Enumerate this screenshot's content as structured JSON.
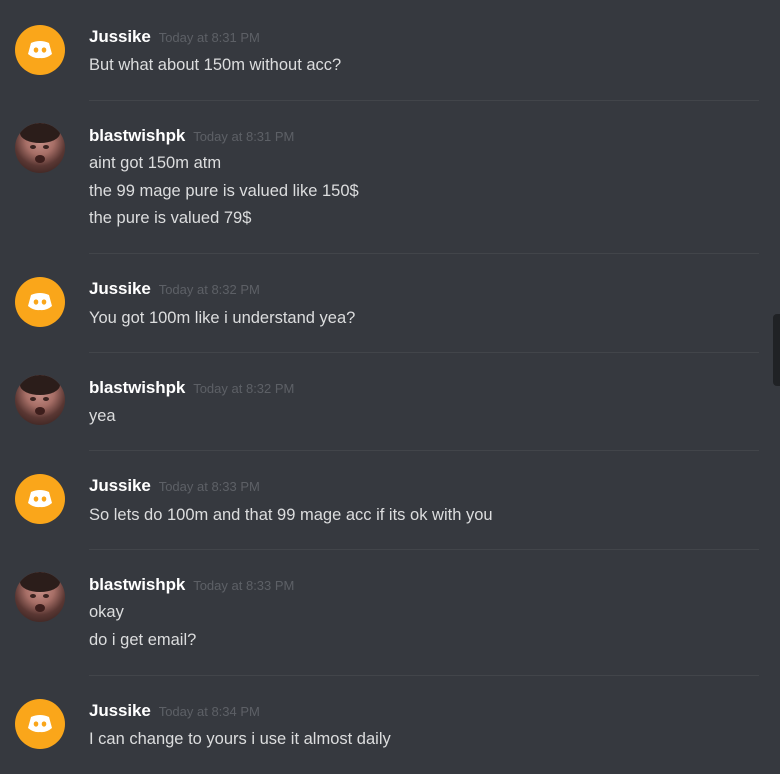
{
  "messages": [
    {
      "author": "Jussike",
      "avatar": "discord-logo-icon",
      "timestamp": "Today at 8:31 PM",
      "lines": [
        "But what about 150m without acc?"
      ]
    },
    {
      "author": "blastwishpk",
      "avatar": "user-photo",
      "timestamp": "Today at 8:31 PM",
      "lines": [
        "aint got 150m atm",
        "the 99 mage pure is valued like 150$",
        "the pure is valued 79$"
      ]
    },
    {
      "author": "Jussike",
      "avatar": "discord-logo-icon",
      "timestamp": "Today at 8:32 PM",
      "lines": [
        "You got 100m like i understand yea?"
      ]
    },
    {
      "author": "blastwishpk",
      "avatar": "user-photo",
      "timestamp": "Today at 8:32 PM",
      "lines": [
        "yea"
      ]
    },
    {
      "author": "Jussike",
      "avatar": "discord-logo-icon",
      "timestamp": "Today at 8:33 PM",
      "lines": [
        "So lets do 100m and that 99 mage acc if its ok with you"
      ]
    },
    {
      "author": "blastwishpk",
      "avatar": "user-photo",
      "timestamp": "Today at 8:33 PM",
      "lines": [
        "okay",
        "do i get email?"
      ]
    },
    {
      "author": "Jussike",
      "avatar": "discord-logo-icon",
      "timestamp": "Today at 8:34 PM",
      "lines": [
        "I can change to yours i use it almost daily"
      ]
    }
  ],
  "colors": {
    "background": "#36393f",
    "discord_avatar": "#faa61a",
    "username": "#ffffff",
    "message_text": "#dcddde",
    "timestamp": "#5d6066",
    "divider": "#42454a"
  }
}
